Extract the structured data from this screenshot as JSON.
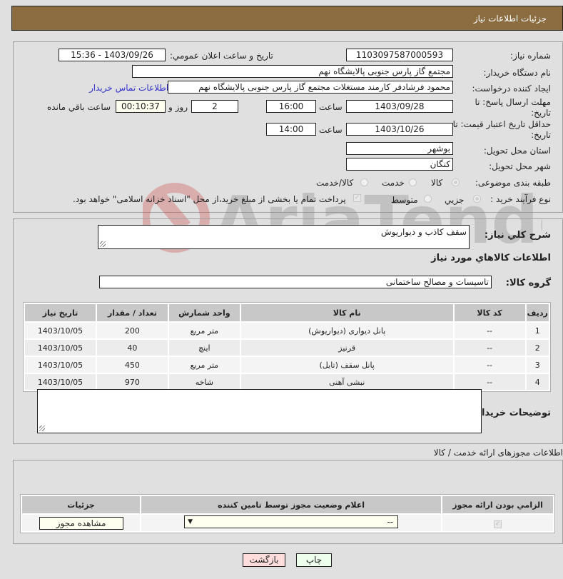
{
  "header": {
    "title": "جزئیات اطلاعات نیاز"
  },
  "form": {
    "need_number_label": "شماره نیاز:",
    "need_number": "1103097587000593",
    "announce_label": "تاریخ و ساعت اعلان عمومي:",
    "announce_value": "1403/09/26 - 15:36",
    "buyer_org_label": "نام دستگاه خریدار:",
    "buyer_org": "مجتمع گاز پارس جنوبی  پالایشگاه نهم",
    "creator_label": "ایجاد کننده درخواست:",
    "creator": "محمود فرشادفر کارمند مستغلات  مجتمع گاز پارس جنوبی  پالایشگاه نهم",
    "contact_link": "اطلاعات تماس خریدار",
    "reply_deadline_label_1": "مهلت ارسال پاسخ: تا",
    "reply_deadline_label_2": "تاریخ:",
    "reply_date": "1403/09/28",
    "time_label": "ساعت",
    "reply_time": "16:00",
    "days": "2",
    "days_label": "روز و",
    "remaining": "00:10:37",
    "remaining_label": "ساعت باقي مانده",
    "validity_label_1": "حداقل تاریخ اعتبار قیمت: تا",
    "validity_label_2": "تاریخ:",
    "validity_date": "1403/10/26",
    "validity_time": "14:00",
    "province_label": "استان محل تحویل:",
    "province": "بوشهر",
    "city_label": "شهر محل تحویل:",
    "city": "کنگان",
    "category_label": "طبقه بندی موضوعی:",
    "category_options": [
      "کالا",
      "خدمت",
      "کالا/خدمت"
    ],
    "category_selected": "کالا",
    "process_label": "نوع فرآیند خرید :",
    "process_options": [
      "جزیي",
      "متوسط"
    ],
    "process_selected": "جزیي",
    "payment_note": "پرداخت تمام یا بخشی از مبلغ خرید،از محل \"اسناد خزانه اسلامی\" خواهد بود."
  },
  "description": {
    "label": "شرح کلي نیاز:",
    "value": "سقف کاذب و دیواریوش"
  },
  "goods": {
    "section_title": "اطلاعات کالاهاي مورد نیاز",
    "group_label": "گروه کالا:",
    "group_value": "تاسیسات و مصالح ساختمانی",
    "columns": [
      "ردیف",
      "کد کالا",
      "نام کالا",
      "واحد شمارش",
      "تعداد / مقدار",
      "تاریخ نیاز"
    ],
    "rows": [
      {
        "idx": "1",
        "code": "--",
        "name": "پانل دیواری (دیواریوش)",
        "unit": "متر مربع",
        "qty": "200",
        "date": "1403/10/05"
      },
      {
        "idx": "2",
        "code": "--",
        "name": "قرنیز",
        "unit": "اینچ",
        "qty": "40",
        "date": "1403/10/05"
      },
      {
        "idx": "3",
        "code": "--",
        "name": "پانل سقف (تایل)",
        "unit": "متر مربع",
        "qty": "450",
        "date": "1403/10/05"
      },
      {
        "idx": "4",
        "code": "--",
        "name": "نبشی آهنی",
        "unit": "شاخه",
        "qty": "970",
        "date": "1403/10/05"
      }
    ]
  },
  "buyer_notes": {
    "label": "توضیحات خریدار:",
    "value": ""
  },
  "permits": {
    "section_title": "اطلاعات مجوزهای ارائه خدمت / کالا",
    "columns": [
      "الزامي بودن ارائه مجوز",
      "اعلام وضعیت مجوز توسط تامین کننده",
      "جزئیات"
    ],
    "row": {
      "required_checked": true,
      "status_value": "--",
      "details_button": "مشاهده مجوز"
    }
  },
  "footer": {
    "print_button": "چاپ",
    "back_button": "بازگشت"
  },
  "colors": {
    "header_bg": "#8c6d42",
    "print_bg": "#eeffee",
    "back_bg": "#ffdddd",
    "link": "#3333cc"
  }
}
